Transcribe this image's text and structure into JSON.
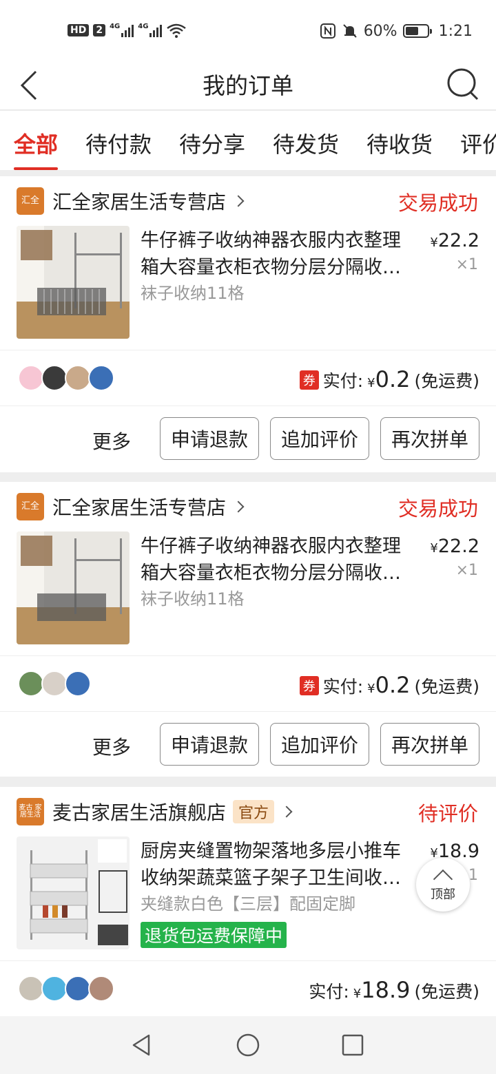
{
  "status_bar": {
    "hd": "HD",
    "sim": "2",
    "net1": "4G",
    "net2": "4G",
    "battery_pct": "60%",
    "battery_level": 0.6,
    "time": "1:21",
    "icons": [
      "nfc-icon",
      "mute-bell-icon",
      "wifi-icon"
    ]
  },
  "header": {
    "title": "我的订单"
  },
  "tabs": [
    "全部",
    "待付款",
    "待分享",
    "待发货",
    "待收货",
    "评价"
  ],
  "orders": [
    {
      "shop": "汇全家居生活专营店",
      "logo_text": "汇全",
      "status": "交易成功",
      "product_line1": "牛仔裤子收纳神器衣服内衣整理",
      "product_line2": "箱大容量衣柜衣物分层分隔收…",
      "spec": "袜子收纳11格",
      "price_symbol": "¥",
      "price": "22.2",
      "qty": "×1",
      "coupon": "券",
      "pay_label": "实付:",
      "pay_symbol": "¥",
      "pay_amount": "0.2",
      "pay_note": "(免运费)",
      "more": "更多",
      "buttons": [
        "申请退款",
        "追加评价",
        "再次拼单"
      ]
    },
    {
      "shop": "汇全家居生活专营店",
      "logo_text": "汇全",
      "status": "交易成功",
      "product_line1": "牛仔裤子收纳神器衣服内衣整理",
      "product_line2": "箱大容量衣柜衣物分层分隔收…",
      "spec": "袜子收纳11格",
      "price_symbol": "¥",
      "price": "22.2",
      "qty": "×1",
      "coupon": "券",
      "pay_label": "实付:",
      "pay_symbol": "¥",
      "pay_amount": "0.2",
      "pay_note": "(免运费)",
      "more": "更多",
      "buttons": [
        "申请退款",
        "追加评价",
        "再次拼单"
      ]
    },
    {
      "shop": "麦古家居生活旗舰店",
      "logo_text": "麦古 家居生活",
      "official": "官方",
      "status": "待评价",
      "product_line1": "厨房夹缝置物架落地多层小推车",
      "product_line2": "收纳架蔬菜篮子架子卫生间收…",
      "spec": "夹缝款白色【三层】配固定脚",
      "guarantee": "退货包运费保障中",
      "price_symbol": "¥",
      "price": "18.9",
      "qty": "×1",
      "pay_label": "实付:",
      "pay_symbol": "¥",
      "pay_amount": "18.9",
      "pay_note": "(免运费)"
    }
  ],
  "top_button": "顶部",
  "colors": {
    "accent": "#e02e24",
    "guarantee_green": "#25b34b",
    "official_bg": "#fbe3c7",
    "logo_orange": "#d97a2b"
  }
}
